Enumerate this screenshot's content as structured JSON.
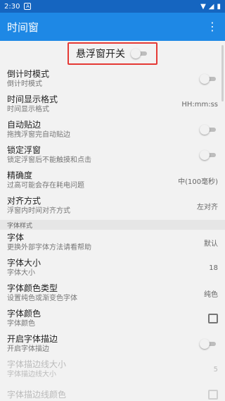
{
  "statusbar": {
    "time": "2:30",
    "notif": "A",
    "wifi": "▼",
    "signal": "◢",
    "battery": "▮"
  },
  "appbar": {
    "title": "时间窗",
    "more_icon": "⋮"
  },
  "master": {
    "label": "悬浮窗开关"
  },
  "settings": [
    {
      "title": "倒计时模式",
      "sub": "倒计时模式",
      "type": "switch"
    },
    {
      "title": "时间显示格式",
      "sub": "时间显示格式",
      "value": "HH:mm:ss"
    },
    {
      "title": "自动贴边",
      "sub": "拖拽浮窗完自动贴边",
      "type": "switch"
    },
    {
      "title": "锁定浮窗",
      "sub": "锁定浮窗后不能触摸和点击",
      "type": "switch"
    },
    {
      "title": "精确度",
      "sub": "过高可能会存在耗电问题",
      "value": "中(100毫秒)"
    },
    {
      "title": "对齐方式",
      "sub": "浮窗内时间对齐方式",
      "value": "左对齐"
    }
  ],
  "font_section": {
    "label": "字体样式"
  },
  "font_settings": [
    {
      "title": "字体",
      "sub": "更换外部字体方法请看帮助",
      "value": "默认"
    },
    {
      "title": "字体大小",
      "sub": "字体大小",
      "value": "18"
    },
    {
      "title": "字体颜色类型",
      "sub": "设置纯色或渐变色字体",
      "value": "纯色"
    },
    {
      "title": "字体颜色",
      "sub": "字体颜色",
      "type": "checkbox"
    },
    {
      "title": "开启字体描边",
      "sub": "开启字体描边",
      "type": "switch"
    },
    {
      "title": "字体描边线大小",
      "sub": "字体描边线大小",
      "value": "5",
      "disabled": true
    },
    {
      "title": "字体描边线颜色",
      "sub": "",
      "type": "checkbox",
      "disabled": true
    }
  ]
}
